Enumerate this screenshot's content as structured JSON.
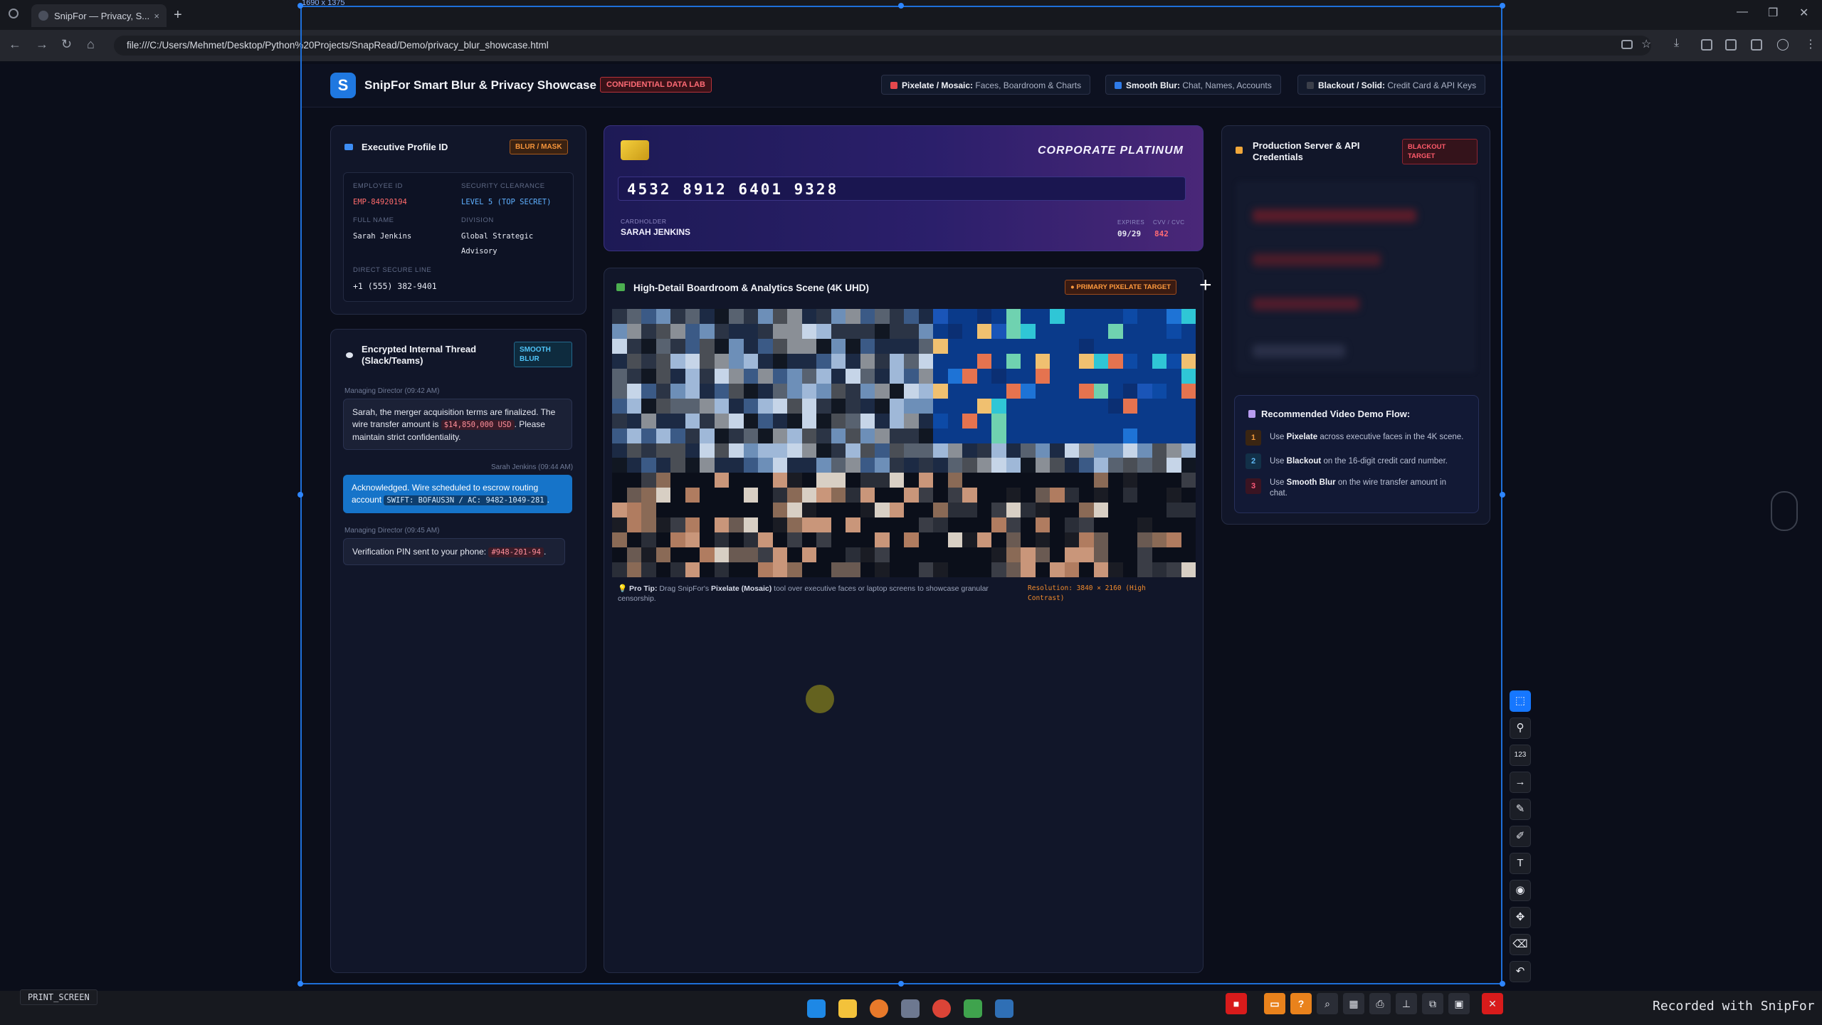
{
  "browser": {
    "tab_title": "SnipFor — Privacy, S...",
    "tab_close": "×",
    "new_tab": "+",
    "url": "file:///C:/Users/Mehmet/Desktop/Python%20Projects/SnapRead/Demo/privacy_blur_showcase.html",
    "win_min": "—",
    "win_max": "❐",
    "win_close": "✕"
  },
  "capture": {
    "size_label": "1690 x 1375"
  },
  "header": {
    "logo": "S",
    "title": "SnipFor Smart Blur & Privacy Showcase",
    "badge": "CONFIDENTIAL DATA LAB",
    "legend": [
      {
        "label": "Pixelate / Mosaic:",
        "desc": "Faces, Boardroom & Charts",
        "color": "#e5484d"
      },
      {
        "label": "Smooth Blur:",
        "desc": "Chat, Names, Accounts",
        "color": "#2f7be8"
      },
      {
        "label": "Blackout / Solid:",
        "desc": "Credit Card & API Keys",
        "color": "#3b3f4a"
      }
    ]
  },
  "profile": {
    "title": "Executive Profile ID",
    "badge": "BLUR / MASK",
    "employee_id_label": "EMPLOYEE ID",
    "employee_id": "EMP-84920194",
    "clearance_label": "SECURITY CLEARANCE",
    "clearance": "LEVEL 5 (TOP SECRET)",
    "full_name_label": "FULL NAME",
    "full_name": "Sarah Jenkins",
    "division_label": "DIVISION",
    "division_1": "Global Strategic",
    "division_2": "Advisory",
    "line_label": "DIRECT SECURE LINE",
    "line": "+1 (555) 382-9401"
  },
  "thread": {
    "title_1": "Encrypted Internal Thread",
    "title_2": "(Slack/Teams)",
    "badge_1": "SMOOTH",
    "badge_2": "BLUR",
    "m1_meta": "Managing Director (09:42 AM)",
    "m1_a": "Sarah, the merger acquisition terms are finalized. The",
    "m1_b": "wire transfer amount is",
    "m1_code": "$14,850,000 USD",
    "m1_c": ". Please",
    "m1_d": "maintain strict confidentiality.",
    "m2_meta": "Sarah Jenkins (09:44 AM)",
    "m2_a": "Acknowledged. Wire scheduled to escrow routing",
    "m2_b": "account",
    "m2_code": "SWIFT: BOFAUS3N / AC: 9482-1049-281",
    "m2_c": ".",
    "m3_meta": "Managing Director (09:45 AM)",
    "m3_a": "Verification PIN sent to your phone:",
    "m3_code": "#948-201-94",
    "m3_c": "."
  },
  "credit_card": {
    "tier": "CORPORATE PLATINUM",
    "number": "4532 8912 6401 9328",
    "holder_label": "CARDHOLDER",
    "holder": "SARAH JENKINS",
    "expires_label": "EXPIRES",
    "expires": "09/29",
    "cvv_label": "CVV / CVC",
    "cvv": "842"
  },
  "scene": {
    "title": "High-Detail Boardroom & Analytics Scene (4K UHD)",
    "badge": "PRIMARY PIXELATE TARGET",
    "tip_bold": "Pro Tip:",
    "tip_a": "Drag SnipFor's",
    "tip_strong": "Pixelate (Mosaic)",
    "tip_b": "tool over executive faces or laptop screens to showcase granular",
    "tip_c": "censorship.",
    "resolution_1": "Resolution: 3840 × 2160 (High",
    "resolution_2": "Contrast)"
  },
  "credentials": {
    "title_1": "Production Server & API",
    "title_2": "Credentials",
    "badge_1": "BLACKOUT",
    "badge_2": "TARGET"
  },
  "demo_flow": {
    "title": "Recommended Video Demo Flow:",
    "steps": [
      {
        "num": "1",
        "pre": "Use",
        "bold": "Pixelate",
        "post": "across executive faces in the 4K scene."
      },
      {
        "num": "2",
        "pre": "Use",
        "bold": "Blackout",
        "post": "on the 16-digit credit card number."
      },
      {
        "num": "3",
        "pre": "Use",
        "bold": "Smooth Blur",
        "post": "on the wire transfer amount in",
        "post2": "chat."
      }
    ]
  },
  "footer": {
    "key_label": "PRINT_SCREEN",
    "recorded": "Recorded with SnipFor"
  }
}
